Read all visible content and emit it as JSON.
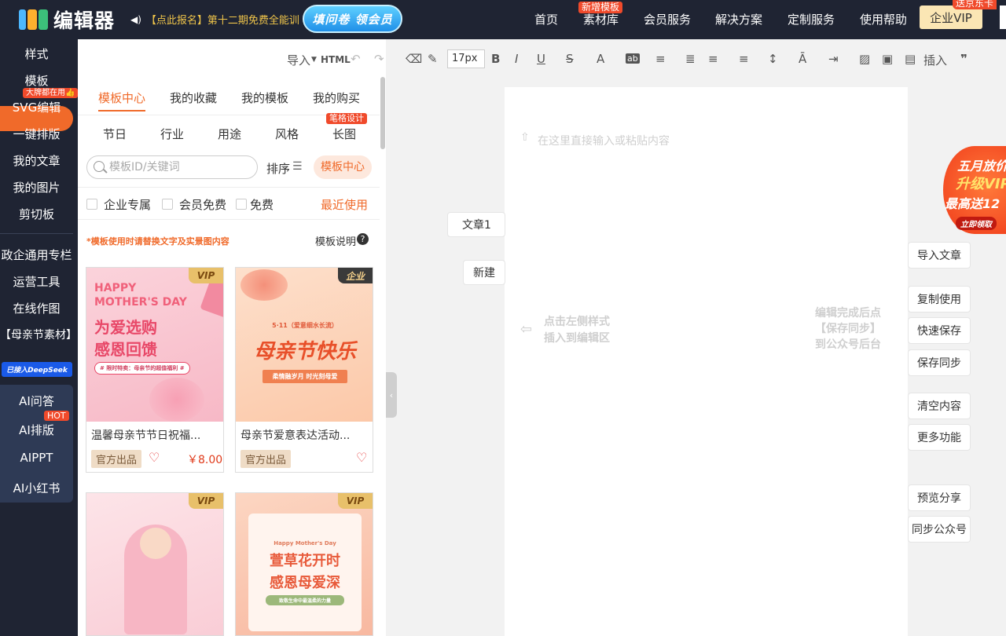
{
  "header": {
    "brand": "编辑器",
    "announcement_icon": "speaker-icon",
    "announcement": "【点此报名】第十二期免费全能训",
    "promo_pill": "填问卷 领会员",
    "nav": [
      "首页",
      "素材库",
      "会员服务",
      "解决方案",
      "定制服务",
      "使用帮助"
    ],
    "nav_badge": "新增模板",
    "vip_button": "企业VIP",
    "vip_badge": "送京东卡"
  },
  "leftnav": {
    "items": [
      "样式",
      "模板",
      "SVG编辑",
      "一键排版",
      "我的文章",
      "我的图片",
      "剪切板",
      "政企通用专栏",
      "运营工具",
      "在线作图",
      "【母亲节素材】"
    ],
    "active": "模板",
    "active_badge": "大牌都在用👍",
    "deepseek_badge": "已接入DeepSeek",
    "ai_items": [
      "AI问答",
      "AI排版",
      "AIPPT",
      "AI小红书"
    ],
    "ai_badge": "HOT"
  },
  "panel": {
    "tabs": [
      "模板中心",
      "我的收藏",
      "我的模板",
      "我的购买"
    ],
    "active_tab": "模板中心",
    "subtabs": [
      "节日",
      "行业",
      "用途",
      "风格",
      "长图"
    ],
    "subtab_badge": "笔格设计",
    "search_placeholder": "模板ID/关键词",
    "sort_label": "排序",
    "center_button": "模板中心",
    "filters": [
      "企业专属",
      "会员免费",
      "免费"
    ],
    "recent": "最近使用",
    "notice": "*模板使用时请替换文字及实景图内容",
    "help": "模板说明",
    "cards": [
      {
        "title": "温馨母亲节节日祝福...",
        "tag": "VIP",
        "official": "官方出品",
        "price": "￥8.00",
        "line1": "HAPPY",
        "line2": "MOTHER'S DAY",
        "headline1": "为爱选购",
        "headline2": "感恩回馈",
        "sub": "# 限时特卖：母亲节的超值福利 #"
      },
      {
        "title": "母亲节爱意表达活动...",
        "tag": "企业",
        "official": "官方出品",
        "price": "",
        "date": "5·11（爱意细水长流）",
        "headline1": "母亲节快乐",
        "sub": "柔情融岁月 时光刻母爱"
      },
      {
        "title": "",
        "tag": "VIP",
        "official": "",
        "price": ""
      },
      {
        "title": "",
        "tag": "VIP",
        "official": "",
        "price": "",
        "line1": "Happy Mother's Day",
        "headline1": "萱草花开时",
        "headline2": "感恩母爱深",
        "sub": "致敬生命中最温柔的力量"
      }
    ]
  },
  "toolbar": {
    "import": "导入",
    "html": "HTML",
    "font_size": "17px",
    "insert": "插入"
  },
  "editor": {
    "placeholder_top": "在这里直接输入或粘贴内容",
    "hint_left_1": "点击左侧样式",
    "hint_left_2": "插入到编辑区",
    "hint_right_1": "编辑完成后点",
    "hint_right_2": "【保存同步】",
    "hint_right_3": "到公众号后台"
  },
  "articles": {
    "current": "文章1",
    "new": "新建"
  },
  "side_buttons": [
    "导入文章",
    "复制使用",
    "快速保存",
    "保存同步",
    "清空内容",
    "更多功能",
    "预览分享",
    "同步公众号"
  ],
  "float_ad": {
    "line1": "五月放价",
    "line2": "升级VIP",
    "line3": "最高送12",
    "cta": "立即领取"
  }
}
